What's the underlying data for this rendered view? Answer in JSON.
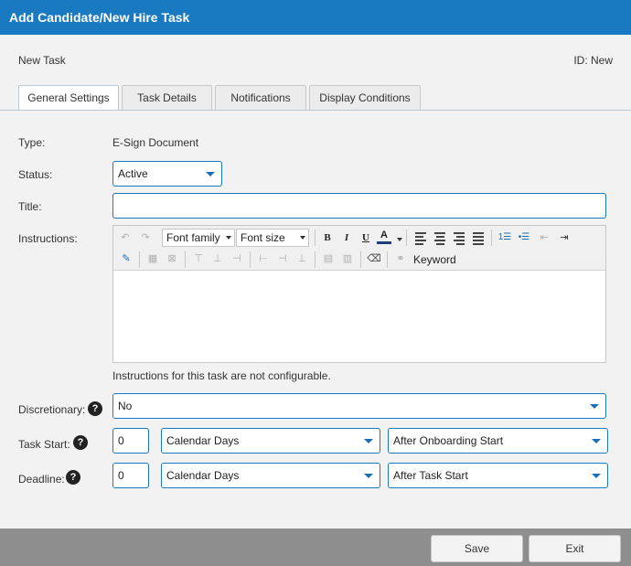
{
  "window": {
    "title": "Add Candidate/New Hire Task"
  },
  "header": {
    "task_name": "New Task",
    "task_id": "ID: New"
  },
  "tabs": [
    {
      "label": "General Settings",
      "active": true
    },
    {
      "label": "Task Details"
    },
    {
      "label": "Notifications"
    },
    {
      "label": "Display Conditions"
    }
  ],
  "form": {
    "type": {
      "label": "Type:",
      "value": "E-Sign Document"
    },
    "status": {
      "label": "Status:",
      "value": "Active"
    },
    "title": {
      "label": "Title:",
      "value": ""
    },
    "instructions": {
      "label": "Instructions:",
      "font_family": "Font family",
      "font_size": "Font size",
      "keyword_label": "Keyword",
      "note": "Instructions for this task are not configurable."
    },
    "discretionary": {
      "label": "Discretionary:",
      "value": "No"
    },
    "task_start": {
      "label": "Task Start:",
      "amount": "0",
      "unit": "Calendar Days",
      "relative_to": "After Onboarding Start"
    },
    "deadline": {
      "label": "Deadline:",
      "amount": "0",
      "unit": "Calendar Days",
      "relative_to": "After Task Start"
    },
    "help_glyph": "?"
  },
  "footer": {
    "save_label": "Save",
    "exit_label": "Exit"
  },
  "colors": {
    "accent": "#1a7ac1",
    "footer": "#8e8e8e"
  }
}
